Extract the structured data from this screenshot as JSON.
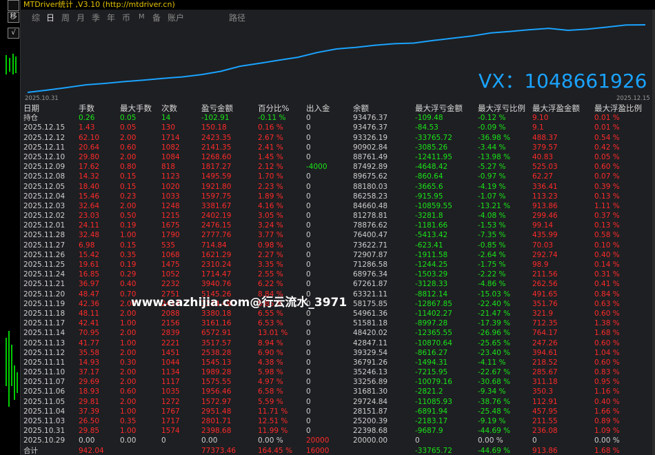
{
  "title": "MTDriver统计 ,V3.10 (http://mtdriver.cn)",
  "left_buttons": [
    "移",
    "√"
  ],
  "tabs": [
    {
      "label": "综",
      "active": false
    },
    {
      "label": "日",
      "active": true
    },
    {
      "label": "周",
      "active": false
    },
    {
      "label": "月",
      "active": false
    },
    {
      "label": "季",
      "active": false
    },
    {
      "label": "年",
      "active": false
    },
    {
      "label": "币",
      "active": false
    },
    {
      "label": "M",
      "active": false
    },
    {
      "label": "备",
      "active": false
    },
    {
      "label": "账户",
      "active": false
    },
    {
      "label": "路径",
      "active": false
    }
  ],
  "chart_data": {
    "type": "line",
    "x_start_label": "2025.10.31",
    "x_end_label": "2025.12.15",
    "x": [
      "2025.10.29",
      "2025.10.31",
      "2025.11.03",
      "2025.11.04",
      "2025.11.05",
      "2025.11.06",
      "2025.11.07",
      "2025.11.10",
      "2025.11.11",
      "2025.11.12",
      "2025.11.13",
      "2025.11.14",
      "2025.11.17",
      "2025.11.18",
      "2025.11.19",
      "2025.11.20",
      "2025.11.21",
      "2025.11.24",
      "2025.11.25",
      "2025.11.26",
      "2025.11.27",
      "2025.11.28",
      "2025.12.01",
      "2025.12.02",
      "2025.12.03",
      "2025.12.04",
      "2025.12.05",
      "2025.12.08",
      "2025.12.09",
      "2025.12.10",
      "2025.12.11",
      "2025.12.12",
      "2025.12.15"
    ],
    "values": [
      20000.0,
      22398.68,
      25200.39,
      28151.87,
      29724.84,
      31681.3,
      33256.89,
      35246.13,
      36791.26,
      39329.54,
      42847.11,
      48420.02,
      51581.18,
      54961.36,
      58175.85,
      63321.11,
      67261.87,
      68976.34,
      71286.58,
      72907.87,
      73622.71,
      76400.47,
      78876.62,
      81278.81,
      84660.48,
      86258.23,
      88180.03,
      89675.62,
      87492.89,
      88761.49,
      90902.84,
      93326.19,
      93476.37
    ],
    "line_color": "#1aa3ff",
    "grid": false
  },
  "watermarks": {
    "vx": "VX：1048661926",
    "url": "www.eazhijia.com@行云流水_3971"
  },
  "table": {
    "headers": [
      "日期",
      "手数",
      "最大手数",
      "次数",
      "盈亏金额",
      "百分比%",
      "出入金",
      "余额",
      "最大浮亏金额",
      "最大浮亏比例",
      "最大浮盈金额",
      "最大浮盈比例"
    ],
    "holding": [
      "持仓",
      "0.26",
      "0.05",
      "14",
      "-102.91",
      "-0.11 %",
      "0",
      "93476.37",
      "-109.48",
      "-0.12 %",
      "9.10",
      "0.01 %"
    ],
    "rows": [
      [
        "2025.12.15",
        "1.43",
        "0.05",
        "130",
        "150.18",
        "0.16 %",
        "0",
        "93476.37",
        "-84.53",
        "-0.09 %",
        "9.1",
        "0.01 %"
      ],
      [
        "2025.12.12",
        "62.10",
        "2.00",
        "1714",
        "2423.35",
        "2.67 %",
        "0",
        "93326.19",
        "-33765.72",
        "-36.98 %",
        "488.37",
        "0.54 %"
      ],
      [
        "2025.12.11",
        "20.64",
        "0.60",
        "1082",
        "2141.35",
        "2.41 %",
        "0",
        "90902.84",
        "-3085.26",
        "-3.44 %",
        "379.57",
        "0.42 %"
      ],
      [
        "2025.12.10",
        "29.80",
        "2.00",
        "1084",
        "1268.60",
        "1.45 %",
        "0",
        "88761.49",
        "-12411.95",
        "-13.98 %",
        "40.83",
        "0.05 %"
      ],
      [
        "2025.12.09",
        "17.62",
        "0.80",
        "818",
        "1817.27",
        "2.12 %",
        "-4000",
        "87492.89",
        "-4648.42",
        "-5.27 %",
        "525.03",
        "0.60 %"
      ],
      [
        "2025.12.08",
        "14.32",
        "0.15",
        "1123",
        "1495.59",
        "1.70 %",
        "0",
        "89675.62",
        "-860.64",
        "-0.97 %",
        "62.27",
        "0.07 %"
      ],
      [
        "2025.12.05",
        "18.40",
        "0.15",
        "1020",
        "1921.80",
        "2.23 %",
        "0",
        "88180.03",
        "-3665.6",
        "-4.19 %",
        "336.41",
        "0.39 %"
      ],
      [
        "2025.12.04",
        "15.46",
        "0.23",
        "1033",
        "1597.75",
        "1.89 %",
        "0",
        "86258.23",
        "-915.95",
        "-1.07 %",
        "113.23",
        "0.13 %"
      ],
      [
        "2025.12.03",
        "32.64",
        "2.00",
        "1248",
        "3381.67",
        "4.16 %",
        "0",
        "84660.48",
        "-10859.55",
        "-13.21 %",
        "913.86",
        "1.11 %"
      ],
      [
        "2025.12.02",
        "23.03",
        "0.50",
        "1215",
        "2402.19",
        "3.05 %",
        "0",
        "81278.81",
        "-3281.8",
        "-4.08 %",
        "299.46",
        "0.37 %"
      ],
      [
        "2025.12.01",
        "24.11",
        "0.19",
        "1675",
        "2476.15",
        "3.24 %",
        "0",
        "78876.62",
        "-1181.66",
        "-1.53 %",
        "99.14",
        "0.13 %"
      ],
      [
        "2025.11.28",
        "32.48",
        "1.00",
        "1790",
        "2777.76",
        "3.77 %",
        "0",
        "76400.47",
        "-5413.42",
        "-7.35 %",
        "435.99",
        "0.58 %"
      ],
      [
        "2025.11.27",
        "6.98",
        "0.15",
        "535",
        "714.84",
        "0.98 %",
        "0",
        "73622.71",
        "-623.41",
        "-0.85 %",
        "70.03",
        "0.10 %"
      ],
      [
        "2025.11.26",
        "15.42",
        "0.35",
        "1068",
        "1621.29",
        "2.27 %",
        "0",
        "72907.87",
        "-1911.58",
        "-2.64 %",
        "292.74",
        "0.40 %"
      ],
      [
        "2025.11.25",
        "19.61",
        "0.19",
        "1475",
        "2310.24",
        "3.35 %",
        "0",
        "71286.58",
        "-1244.25",
        "-1.75 %",
        "98.9",
        "0.14 %"
      ],
      [
        "2025.11.24",
        "16.85",
        "0.29",
        "1052",
        "1714.47",
        "2.55 %",
        "0",
        "68976.34",
        "-1503.29",
        "-2.22 %",
        "211.56",
        "0.31 %"
      ],
      [
        "2025.11.21",
        "36.97",
        "0.40",
        "2232",
        "3940.76",
        "6.22 %",
        "0",
        "67261.87",
        "-3128.33",
        "-4.86 %",
        "262.56",
        "0.41 %"
      ],
      [
        "2025.11.20",
        "48.47",
        "0.70",
        "2751",
        "5145.26",
        "8.84 %",
        "0",
        "63321.11",
        "-8812.14",
        "-15.03 %",
        "491.65",
        "0.84 %"
      ],
      [
        "2025.11.19",
        "42.36",
        "2.00",
        "2424",
        "3214.49",
        "5.85 %",
        "0",
        "58175.85",
        "-12867.85",
        "-22.40 %",
        "351.76",
        "0.63 %"
      ],
      [
        "2025.11.18",
        "48.11",
        "2.00",
        "2088",
        "3380.18",
        "6.55 %",
        "0",
        "54961.36",
        "-11402.27",
        "-21.47 %",
        "321.9",
        "0.60 %"
      ],
      [
        "2025.11.17",
        "42.41",
        "1.00",
        "2156",
        "3161.16",
        "6.53 %",
        "0",
        "51581.18",
        "-8997.28",
        "-17.39 %",
        "712.35",
        "1.38 %"
      ],
      [
        "2025.11.14",
        "70.95",
        "2.00",
        "2839",
        "6572.91",
        "13.01 %",
        "0",
        "48420.02",
        "-12365.55",
        "-26.96 %",
        "764.17",
        "1.68 %"
      ],
      [
        "2025.11.13",
        "41.77",
        "1.00",
        "2221",
        "3517.57",
        "8.94 %",
        "0",
        "42847.11",
        "-10870.64",
        "-25.65 %",
        "247.26",
        "0.60 %"
      ],
      [
        "2025.11.12",
        "35.58",
        "2.00",
        "1451",
        "2538.28",
        "6.90 %",
        "0",
        "39329.54",
        "-8616.27",
        "-23.40 %",
        "394.61",
        "1.04 %"
      ],
      [
        "2025.11.11",
        "14.93",
        "0.30",
        "1044",
        "1545.13",
        "4.38 %",
        "0",
        "36791.26",
        "-1494.31",
        "-4.11 %",
        "218.52",
        "0.60 %"
      ],
      [
        "2025.11.10",
        "37.17",
        "2.00",
        "1134",
        "1989.28",
        "5.98 %",
        "0",
        "35246.13",
        "-7215.95",
        "-22.67 %",
        "285.67",
        "0.83 %"
      ],
      [
        "2025.11.07",
        "29.69",
        "2.00",
        "1117",
        "1575.55",
        "4.97 %",
        "0",
        "33256.89",
        "-10079.16",
        "-30.68 %",
        "311.18",
        "0.95 %"
      ],
      [
        "2025.11.06",
        "18.93",
        "0.60",
        "1035",
        "1956.46",
        "6.58 %",
        "0",
        "31681.30",
        "-2821.2",
        "-9.34 %",
        "350.3",
        "1.16 %"
      ],
      [
        "2025.11.05",
        "29.81",
        "2.00",
        "1272",
        "1572.97",
        "5.59 %",
        "0",
        "29724.84",
        "-11085.93",
        "-38.76 %",
        "112.91",
        "0.40 %"
      ],
      [
        "2025.11.04",
        "37.39",
        "1.00",
        "1767",
        "2951.48",
        "11.71 %",
        "0",
        "28151.87",
        "-6891.94",
        "-25.48 %",
        "457.95",
        "1.66 %"
      ],
      [
        "2025.11.03",
        "26.50",
        "0.35",
        "1717",
        "2801.71",
        "12.51 %",
        "0",
        "25200.39",
        "-2183.17",
        "-9.19 %",
        "211.55",
        "0.89 %"
      ],
      [
        "2025.10.31",
        "29.85",
        "1.00",
        "1574",
        "2398.68",
        "11.99 %",
        "0",
        "22398.68",
        "-9687.9",
        "-44.69 %",
        "236.08",
        "1.09 %"
      ],
      [
        "2025.10.29",
        "0.00",
        "0.00",
        "0",
        "0.00",
        "0.00 %",
        "20000",
        "20000.00",
        "0",
        "0.00 %",
        "0",
        "0.00 %"
      ]
    ],
    "total": [
      "合计",
      "942.04",
      "",
      "",
      "77373.46",
      "164.45 %",
      "16000",
      "",
      "-33765.72",
      "-44.69 %",
      "913.86",
      "1.68 %"
    ]
  }
}
